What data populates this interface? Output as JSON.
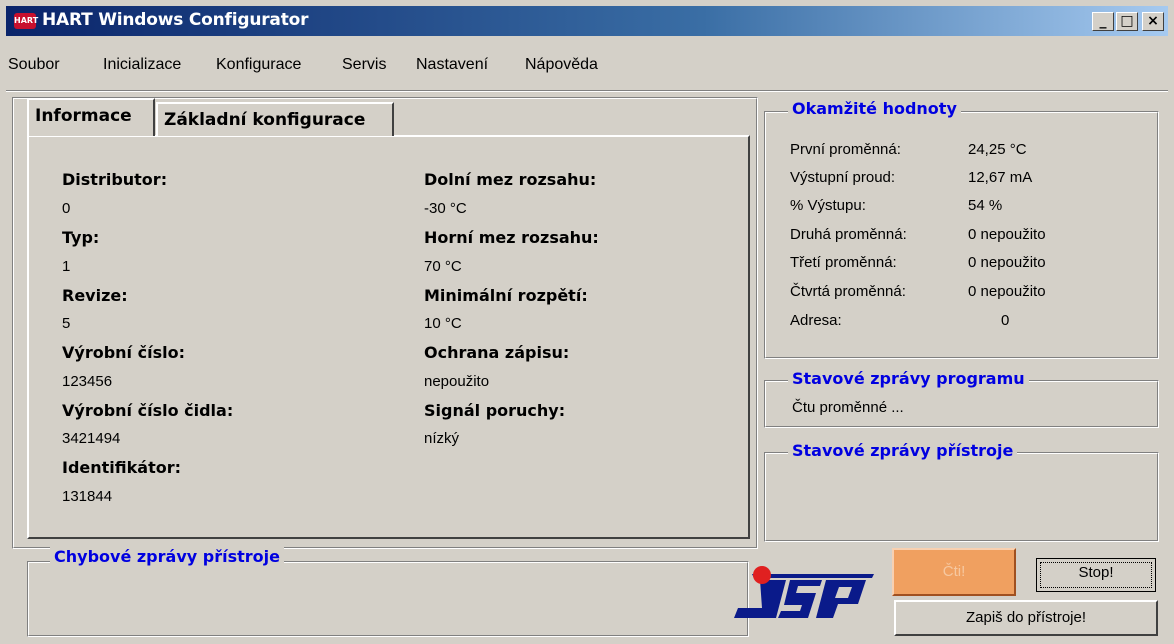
{
  "window": {
    "title": "HART Windows Configurator",
    "icon_label": "HART",
    "controls": {
      "minimize": "_",
      "maximize": "□",
      "close": "×"
    }
  },
  "menu": [
    "Soubor",
    "Inicializace",
    "Konfigurace",
    "Servis",
    "Nastavení",
    "Nápověda"
  ],
  "tabs": {
    "active": "Informace",
    "other": "Základní konfigurace"
  },
  "info": {
    "left": [
      {
        "label": "Distributor:",
        "value": "0"
      },
      {
        "label": "Typ:",
        "value": "1"
      },
      {
        "label": "Revize:",
        "value": "5"
      },
      {
        "label": "Výrobní číslo:",
        "value": "123456"
      },
      {
        "label": "Výrobní číslo čidla:",
        "value": "3421494"
      },
      {
        "label": "Identifikátor:",
        "value": "131844"
      }
    ],
    "right": [
      {
        "label": "Dolní mez rozsahu:",
        "value": "-30 °C"
      },
      {
        "label": "Horní mez rozsahu:",
        "value": "70 °C"
      },
      {
        "label": "Minimální rozpětí:",
        "value": "10 °C"
      },
      {
        "label": "Ochrana zápisu:",
        "value": "nepoužito"
      },
      {
        "label": "Signál poruchy:",
        "value": "nízký"
      }
    ]
  },
  "instant": {
    "title": "Okamžité hodnoty",
    "rows": [
      {
        "label": "První proměnná:",
        "value": "24,25 °C"
      },
      {
        "label": "Výstupní proud:",
        "value": "12,67 mA"
      },
      {
        "label": "% Výstupu:",
        "value": "54 %"
      },
      {
        "label": "Druhá proměnná:",
        "value": "0 nepoužito"
      },
      {
        "label": "Třetí proměnná:",
        "value": "0 nepoužito"
      },
      {
        "label": "Čtvrtá proměnná:",
        "value": "0 nepoužito"
      },
      {
        "label": "Adresa:",
        "value": "0"
      }
    ]
  },
  "program_status": {
    "title": "Stavové zprávy programu",
    "text": "Čtu proměnné ..."
  },
  "device_status": {
    "title": "Stavové zprávy přístroje"
  },
  "device_errors": {
    "title": "Chybové zprávy přístroje"
  },
  "buttons": {
    "read": "Čti!",
    "stop": "Stop!",
    "write": "Zapiš do přístroje!"
  },
  "logo": {
    "text": "JSP"
  },
  "colors": {
    "group_title": "#0000e0",
    "read_button": "#f0a060"
  }
}
